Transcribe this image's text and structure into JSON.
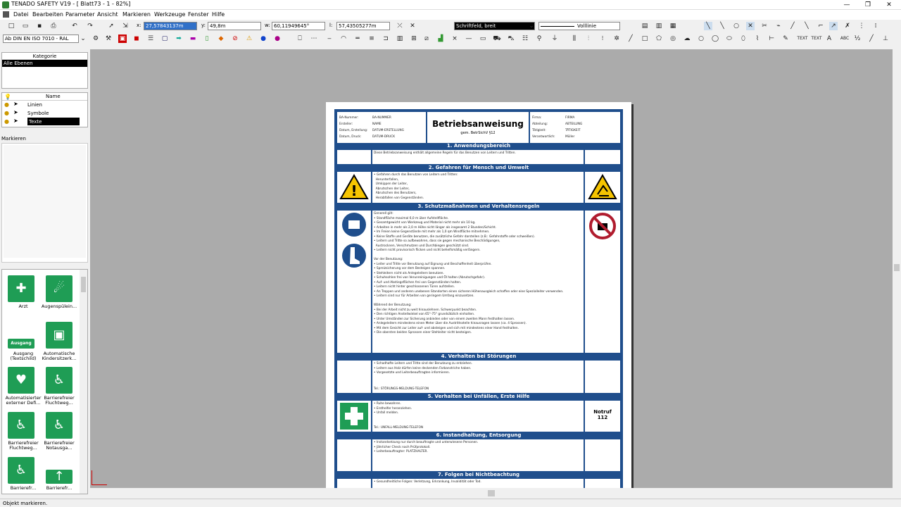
{
  "window": {
    "title": "TENADO SAFETY V19 - [ Blatt73 - 1 - 82%]",
    "minimize": "—",
    "restore": "❐",
    "close": "✕"
  },
  "menu": [
    "Datei",
    "Bearbeiten",
    "Parameter",
    "Ansicht",
    "Markieren",
    "Werkzeuge",
    "Fenster",
    "Hilfe"
  ],
  "coords": {
    "x_label": "x:",
    "x_value": "27,57843137m",
    "y_label": "y:",
    "y_value": "49,8m",
    "w_label": "w:",
    "w_value": "60,11949645°",
    "l_label": "l:",
    "l_value": "57,43505277m"
  },
  "pen_select": "Schriftfeld, breit",
  "line_select": "Volllinie",
  "font_select": "Ab DIN EN ISO 7010 - RAL",
  "category": {
    "header": "Kategorie",
    "selected": "Alle Ebenen"
  },
  "layers": {
    "header": "Name",
    "items": [
      "Linien",
      "Symbole",
      "Texte"
    ]
  },
  "markieren_tab": "Markieren",
  "symbols": [
    {
      "label": "Arzt",
      "icon": "doctor-icon",
      "glyph": "✚"
    },
    {
      "label": "Augenspülein...",
      "icon": "eye-wash-icon",
      "glyph": "☄"
    },
    {
      "label": "Ausgang (Textschild)",
      "icon": "exit-sign-icon",
      "glyph": "Ausgang"
    },
    {
      "label": "Automatische Kindersitzerk...",
      "icon": "child-seat-icon",
      "glyph": "▣"
    },
    {
      "label": "Automatisierter externer Defi...",
      "icon": "defibrillator-icon",
      "glyph": "♥"
    },
    {
      "label": "Barrierefreier Fluchtweg...",
      "icon": "accessible-exit-icon",
      "glyph": "♿"
    },
    {
      "label": "Barrierefreier Fluchtweg...",
      "icon": "accessible-exit-icon",
      "glyph": "♿"
    },
    {
      "label": "Barrierefreier Notausga...",
      "icon": "accessible-emergency-exit-icon",
      "glyph": "♿"
    },
    {
      "label": "Barrierefr...",
      "icon": "accessible-icon",
      "glyph": "♿"
    },
    {
      "label": "Barrierefr...",
      "icon": "accessible-arrow-icon",
      "glyph": "↑"
    }
  ],
  "doc": {
    "header_left": [
      [
        "BA-Nummer:",
        "BA-NUMMER"
      ],
      [
        "Ersteller:",
        "NAME"
      ],
      [
        "Datum, Erstellung:",
        "DATUM-ERSTELLUNG"
      ],
      [
        "Datum, Druck:",
        "DATUM-DRUCK"
      ]
    ],
    "title": "Betriebsanweisung",
    "subtitle": "gem. BetrSichV §12",
    "header_right": [
      [
        "Firma:",
        "FIRMA"
      ],
      [
        "Abteilung:",
        "ABTEILUNG"
      ],
      [
        "Tätigkeit:",
        "TÄTIGKEIT"
      ],
      [
        "Verantwortlich:",
        "Müller"
      ]
    ],
    "s1": "1. Anwendungsbereich",
    "s1_text": "Diese Betriebsanweisung enthält allgemeine Regeln für das Benutzen von Leitern und Tritten.",
    "s2": "2. Gefahren für Mensch und Umwelt",
    "s2_text": "• Gefahren durch das Benutzen von Leitern und Tritten:\n  Herunterfallen,\n  Umkippen der Leiter,\n  Abrutschen der Leiter,\n  Abrutschen des Benutzers,\n  Herabfallen von Gegenständen.",
    "s3": "3. Schutzmaßnahmen und Verhaltensregeln",
    "s3_text": "Generell gilt:\n• Standfläche maximal 6,0 m über Aufstellfläche.\n• Gesamtgewicht von Werkzeug und Material nicht mehr als 10 kg.\n• Arbeiten in mehr als 2,0 m Höhe nicht länger als insgesamt 2 Stunden/Schicht.\n• Im Freien keine Gegenstände mit mehr als 1,0 qm Windfläche mitnehmen.\n• Keine Stoffe und Geräte benutzen, die zusätzliche Gefahr darstellen (z.B.: Gefahrstoffe oder schweißen).\n• Leitern und Tritte so aufbewahren, dass sie gegen mechanische Beschädigungen,\n  Austrocknen, Verschmutzen und Durchbiegen geschützt sind.\n• Leitern nicht provisorisch flicken und nicht behelfsmäßig verlängern.\n\nVor der Benutzung:\n• Leiter und Tritte vor Benutzung auf Eignung und Beschaffenheit überprüfen.\n• Spreizsicherung vor dem Besteigen spannen.\n• Stehleitern nicht als Anlegeleitern benutzen.\n• Schuhsohlen frei von Verunreinigungen und Öl halten (Abrutschgefahr).\n• Auf- und Abstiegsflächen frei von Gegenständen halten.\n• Leitern nicht hinter geschlossenen Türen aufstellen.\n• An Treppen und anderen unebenen Standorten einen sicheren Höhenausgleich schaffen oder eine Spezialleiter verwenden.\n• Leitern sind nur für Arbeiten von geringem Umfang einzusetzen.\n\nWährend der Benutzung:\n• Bei der Arbeit nicht zu weit hinauslehnen. Schwerpunkt beachten.\n• Den richtigen Anstellwinkel von 65°-75° grundsätzlich einhalten.\n• Unter Umständen zur Sicherung anbinden oder von einem zweiten Mann festhalten lassen.\n• Anlegeleitern mindestens einen Meter über die Austrittsstelle hinausragen lassen (ca. 4 Sprossen).\n• Mit dem Gesicht zur Leiter auf- und absteigen und sich mit mindestens einer Hand festhalten.\n• Die obersten beiden Sprossen einer Stehleiter nicht besteigen.",
    "s4": "4. Verhalten bei Störungen",
    "s4_text": "• Schadhafte Leitern und Tritte sind der Benutzung zu entziehen.\n• Leitern aus Holz dürfen keine deckenden Farbanstriche haben.\n• Vorgesetzte und Leiterbeauftragten informieren.",
    "s4_tel": "Tel.: STÖRUNGS-MELDUNG-TELEFON",
    "s5": "5. Verhalten bei Unfällen, Erste Hilfe",
    "s5_text": "• Ruhe bewahren.\n• Ersthelfer heranziehen.\n• Unfall melden.",
    "s5_tel": "Tel.: UNFALL-MELDUNG-TELEFON",
    "notruf": "Notruf",
    "notruf_num": "112",
    "s6": "6. Instandhaltung, Entsorgung",
    "s6_text": "• Instandsetzung nur durch beauftragte und unterwiesene Personen.\n• Jährlicher Check nach Prüfprotokoll.\n• Leiterbeauftragter: PLATZHALTER.",
    "s7": "7. Folgen bei Nichtbeachtung",
    "s7_text": "• Gesundheitliche Folgen: Verletzung, Erkrankung, Invalidität oder Tod."
  },
  "status": "Objekt markieren.",
  "colors": {
    "doc_blue": "#1f4e8c",
    "safe_green": "#1f9d55",
    "warn_yellow": "#f5c400",
    "prohibit_red": "#b01c2e"
  }
}
